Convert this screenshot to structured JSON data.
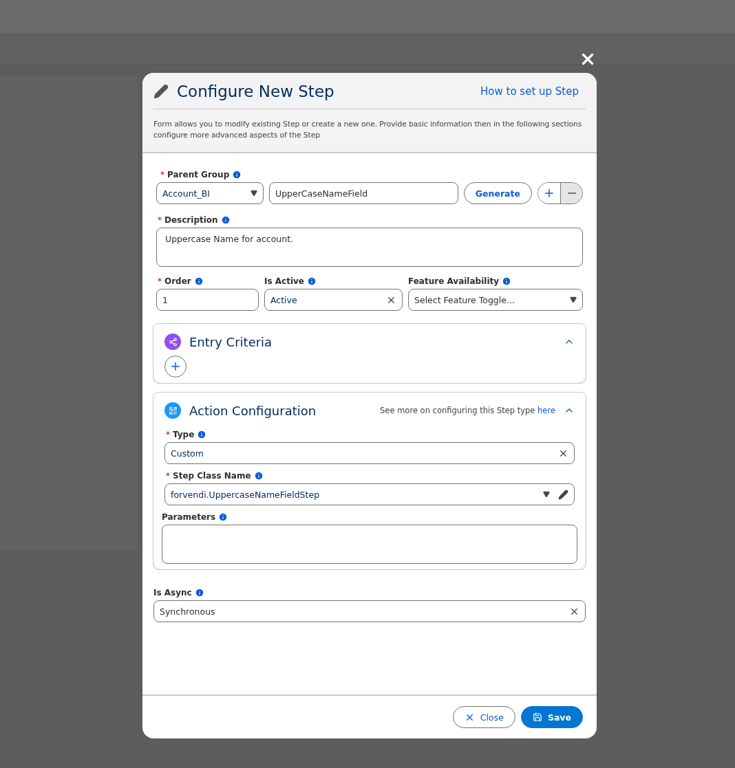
{
  "modal": {
    "title": "Configure New Step",
    "help_link": "How to set up Step",
    "description": "Form allows you to modify existing Step or create a new one. Provide basic information then in the following sections configure more advanced aspects of the Step"
  },
  "parent_group": {
    "label": "Parent Group",
    "required": true,
    "value": "Account_BI",
    "name_value": "UpperCaseNameField",
    "generate_button": "Generate"
  },
  "description_field": {
    "label": "Description",
    "required": true,
    "value": "Uppercase Name for account."
  },
  "order": {
    "label": "Order",
    "required": true,
    "value": "1"
  },
  "is_active": {
    "label": "Is Active",
    "required": false,
    "value": "Active"
  },
  "feature_availability": {
    "label": "Feature Availability",
    "required": false,
    "placeholder": "Select Feature Toggle..."
  },
  "sections": [
    {
      "kind": "entry",
      "title": "Entry Criteria",
      "expanded": true,
      "color": "#9050e9"
    },
    {
      "kind": "action",
      "title": "Action Configuration",
      "expanded": true,
      "color": "#1b96ff",
      "hint": "See more on configuring this Step type ",
      "hint_link": "here",
      "fields": [
        {
          "kind": "clearable",
          "label": "Type",
          "required": true,
          "value": "Custom"
        },
        {
          "kind": "lookup",
          "label": "Step Class Name",
          "required": true,
          "value": "forvendi.UppercaseNameFieldStep"
        },
        {
          "kind": "textarea",
          "label": "Parameters",
          "required": false
        }
      ]
    }
  ],
  "required_mark": "*",
  "is_async": {
    "label": "Is Async",
    "required": false,
    "value": "Synchronous"
  },
  "footer": {
    "close": "Close",
    "save": "Save"
  }
}
